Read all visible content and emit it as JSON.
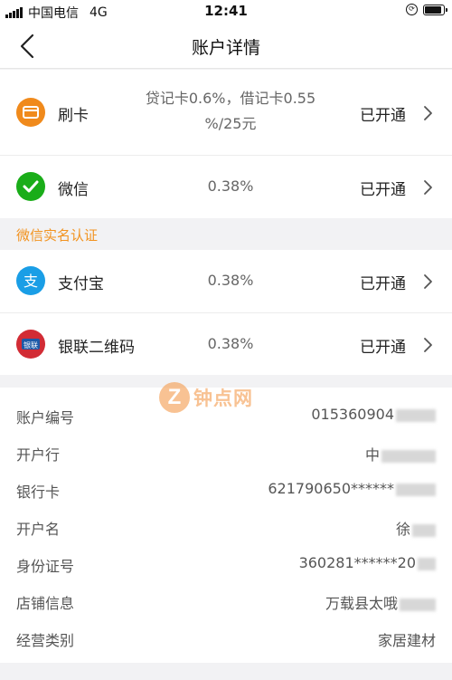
{
  "status_bar": {
    "carrier": "中国电信",
    "network": "4G",
    "time": "12:41",
    "battery_level": 0.9
  },
  "nav": {
    "title": "账户详情",
    "back_icon": "chevron-left-icon"
  },
  "payment_methods": [
    {
      "name": "刷卡",
      "rate_line1": "贷记卡0.6%，借记卡0.55",
      "rate_line2": "%/25元",
      "status": "已开通",
      "icon": "card-icon",
      "color": "#f08a1c"
    },
    {
      "name": "微信",
      "rate": "0.38%",
      "status": "已开通",
      "icon": "wechat-icon",
      "color": "#1aad19"
    },
    {
      "name": "支付宝",
      "rate": "0.38%",
      "status": "已开通",
      "icon": "alipay-icon",
      "color": "#1a9ee6"
    },
    {
      "name": "银联二维码",
      "rate": "0.38%",
      "status": "已开通",
      "icon": "unionpay-icon",
      "color": "#d22c35"
    }
  ],
  "section_wechat_verify": "微信实名认证",
  "account_info": [
    {
      "label": "账户编号",
      "value": "015360904"
    },
    {
      "label": "开户行",
      "value": "中"
    },
    {
      "label": "银行卡",
      "value": "621790650******"
    },
    {
      "label": "开户名",
      "value": "徐"
    },
    {
      "label": "身份证号",
      "value": "360281******20"
    },
    {
      "label": "店铺信息",
      "value": "万载县太哦"
    },
    {
      "label": "经营类别",
      "value": "家居建材"
    }
  ],
  "watermark": {
    "text": "钟点网",
    "mark": "Z"
  },
  "colors": {
    "accent": "#f29320",
    "background": "#f2f2f4"
  }
}
